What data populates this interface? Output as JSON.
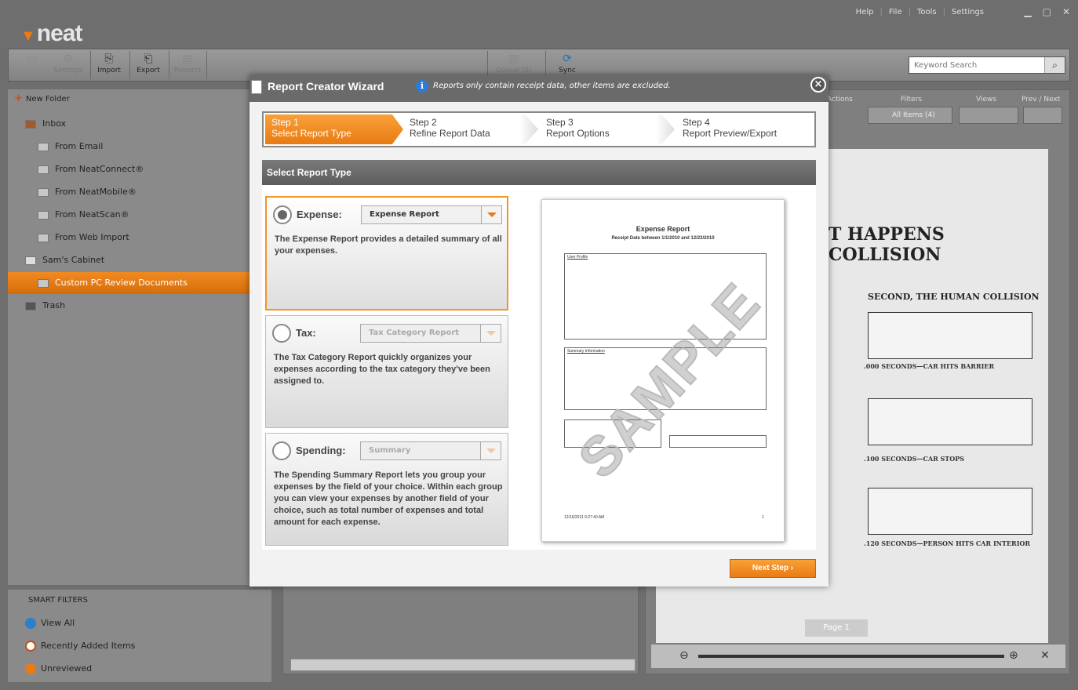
{
  "app": {
    "logo": "neat",
    "menu": [
      "Help",
      "File",
      "Tools",
      "Settings"
    ],
    "toolbar": {
      "buttons": [
        "Settings",
        "Import",
        "Export",
        "Reports",
        "Queue (0)",
        "Sync"
      ],
      "search_placeholder": "Keyword Search"
    },
    "panel_labels": {
      "actions": "Actions",
      "filters": "Filters",
      "filter_value": "All Items (4)",
      "views": "Views",
      "prevnext": "Prev / Next"
    }
  },
  "sidebar": {
    "new_folder": "New Folder",
    "items": [
      {
        "label": "Inbox"
      },
      {
        "label": "From Email"
      },
      {
        "label": "From NeatConnect®"
      },
      {
        "label": "From NeatMobile®"
      },
      {
        "label": "From NeatScan®"
      },
      {
        "label": "From Web Import"
      },
      {
        "label": "Sam's Cabinet"
      },
      {
        "label": "Custom PC Review Documents"
      },
      {
        "label": "Trash"
      }
    ],
    "smart_filters": {
      "header": "SMART FILTERS",
      "items": [
        "View All",
        "Recently Added Items",
        "Unreviewed"
      ]
    }
  },
  "viewer": {
    "headline1": "T HAPPENS",
    "headline2": "COLLISION",
    "subhead": "SECOND, THE HUMAN COLLISION",
    "cap1": ".000 SECONDS—CAR HITS BARRIER",
    "cap2": ".100 SECONDS—CAR STOPS",
    "cap3": ".120 SECONDS—PERSON HITS CAR INTERIOR",
    "page": "Page 1"
  },
  "wizard": {
    "title": "Report Creator Wizard",
    "info": "Reports only contain receipt data, other items are excluded.",
    "steps": [
      {
        "num": "Step 1",
        "label": "Select Report Type"
      },
      {
        "num": "Step 2",
        "label": "Refine Report Data"
      },
      {
        "num": "Step 3",
        "label": "Report Options"
      },
      {
        "num": "Step 4",
        "label": "Report Preview/Export"
      }
    ],
    "section": "Select Report Type",
    "options": [
      {
        "label": "Expense:",
        "select": "Expense Report",
        "desc": "The Expense Report provides a detailed summary of all your expenses."
      },
      {
        "label": "Tax:",
        "select": "Tax Category Report",
        "desc": "The Tax Category Report quickly organizes your expenses according to the tax category they've been assigned to."
      },
      {
        "label": "Spending:",
        "select": "Summary",
        "desc": "The Spending Summary Report lets you group your expenses by the field of your choice. Within each group you can view your expenses by another field of your choice, such as total number of expenses and total amount for each expense."
      }
    ],
    "preview": {
      "title": "Expense Report",
      "subtitle": "Receipt Date between 1/1/2010 and 12/23/2010",
      "user_profile": "User Profile",
      "summary_info": "Summary Information",
      "watermark": "SAMPLE",
      "footer_date": "12/16/2011 9:27:40 AM",
      "footer_page": "1"
    },
    "next_button": "Next Step"
  }
}
